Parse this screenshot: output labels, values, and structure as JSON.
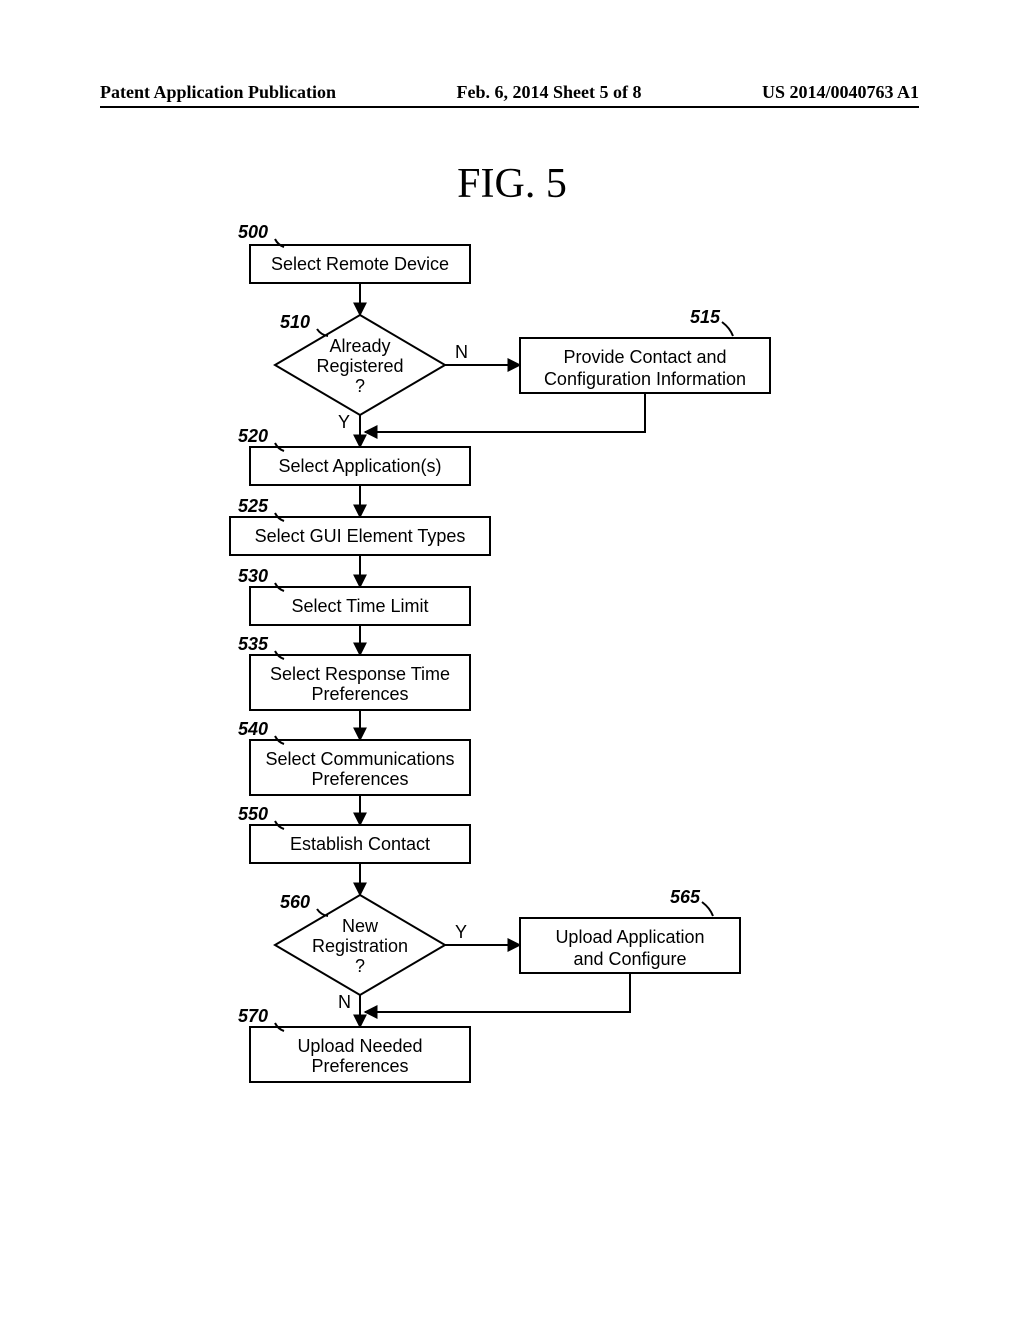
{
  "header": {
    "left": "Patent Application Publication",
    "center": "Feb. 6, 2014  Sheet 5 of 8",
    "right": "US 2014/0040763 A1"
  },
  "figure_title": "FIG. 5",
  "nodes": {
    "n500": {
      "ref": "500",
      "text": "Select Remote Device"
    },
    "n510": {
      "ref": "510",
      "line1": "Already",
      "line2": "Registered",
      "line3": "?"
    },
    "n515": {
      "ref": "515",
      "line1": "Provide Contact and",
      "line2": "Configuration Information"
    },
    "n520": {
      "ref": "520",
      "text": "Select Application(s)"
    },
    "n525": {
      "ref": "525",
      "text": "Select GUI Element Types"
    },
    "n530": {
      "ref": "530",
      "text": "Select Time Limit"
    },
    "n535": {
      "ref": "535",
      "line1": "Select Response Time",
      "line2": "Preferences"
    },
    "n540": {
      "ref": "540",
      "line1": "Select Communications",
      "line2": "Preferences"
    },
    "n550": {
      "ref": "550",
      "text": "Establish Contact"
    },
    "n560": {
      "ref": "560",
      "line1": "New",
      "line2": "Registration",
      "line3": "?"
    },
    "n565": {
      "ref": "565",
      "line1": "Upload Application",
      "line2": "and Configure"
    },
    "n570": {
      "ref": "570",
      "line1": "Upload Needed",
      "line2": "Preferences"
    }
  },
  "labels": {
    "yes": "Y",
    "no": "N"
  }
}
